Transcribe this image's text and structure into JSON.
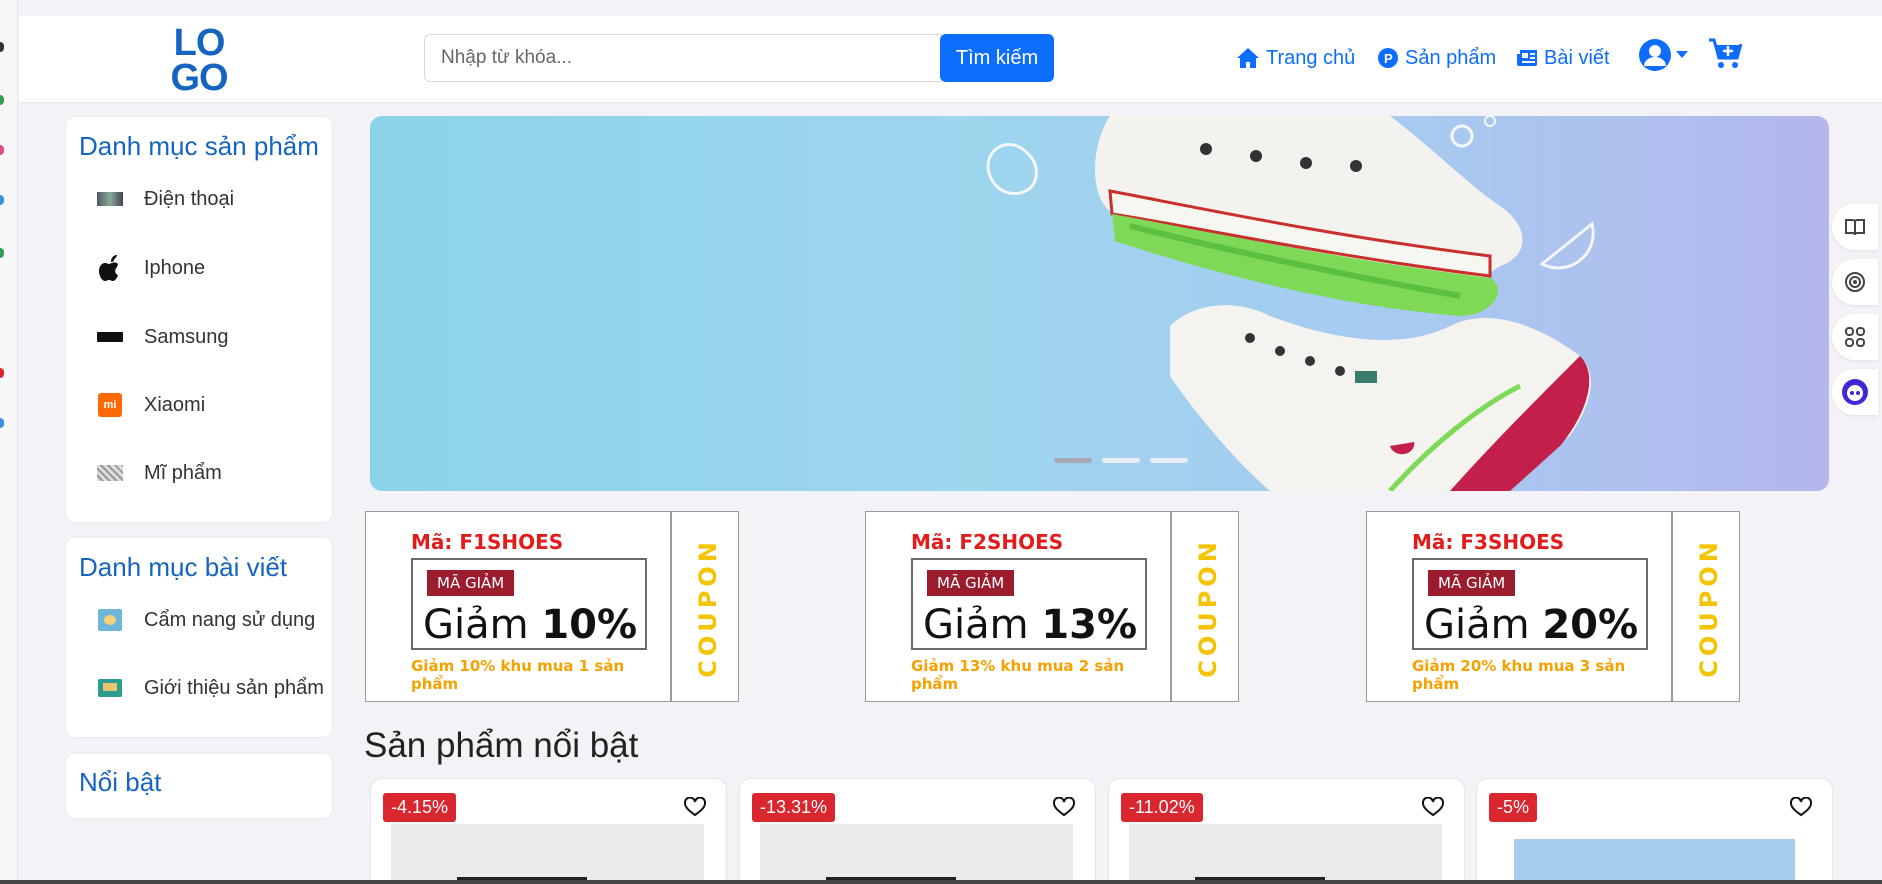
{
  "header": {
    "logo_top": "LO",
    "logo_bottom": "GO",
    "search_placeholder": "Nhập từ khóa...",
    "search_button": "Tìm kiếm",
    "nav": [
      {
        "label": "Trang chủ",
        "icon": "home-icon"
      },
      {
        "label": "Sản phẩm",
        "icon": "product-icon"
      },
      {
        "label": "Bài viết",
        "icon": "newspaper-icon"
      }
    ]
  },
  "sidebar": {
    "product_categories_title": "Danh mục sản phẩm",
    "product_categories": [
      {
        "label": "Điện thoại",
        "icon": "phone-thumbnail-icon"
      },
      {
        "label": "Iphone",
        "icon": "apple-icon"
      },
      {
        "label": "Samsung",
        "icon": "samsung-icon"
      },
      {
        "label": "Xiaomi",
        "icon": "xiaomi-icon"
      },
      {
        "label": "Mĩ phẩm",
        "icon": "cosmetics-thumbnail-icon"
      }
    ],
    "post_categories_title": "Danh mục bài viết",
    "post_categories": [
      {
        "label": "Cẩm nang sử dụng",
        "icon": "guide-thumbnail-icon"
      },
      {
        "label": "Giới thiệu sản phẩm",
        "icon": "intro-thumbnail-icon"
      }
    ],
    "featured_title": "Nổi bật"
  },
  "banner": {
    "slides": 3,
    "active_slide": 1
  },
  "coupons": [
    {
      "code": "Mã: F1SHOES",
      "tag": "MÃ GIẢM",
      "word": "Giảm",
      "percent": "10%",
      "desc": "Giảm 10% khu mua 1 sản phẩm",
      "stub": "COUPON"
    },
    {
      "code": "Mã: F2SHOES",
      "tag": "MÃ GIẢM",
      "word": "Giảm",
      "percent": "13%",
      "desc": "Giảm 13% khu mua 2 sản phẩm",
      "stub": "COUPON"
    },
    {
      "code": "Mã: F3SHOES",
      "tag": "MÃ GIẢM",
      "word": "Giảm",
      "percent": "20%",
      "desc": "Giảm 20% khu mua 3 sản phẩm",
      "stub": "COUPON"
    }
  ],
  "featured": {
    "title": "Sản phẩm nổi bật",
    "products": [
      {
        "discount": "-4.15%"
      },
      {
        "discount": "-13.31%"
      },
      {
        "discount": "-11.02%"
      },
      {
        "discount": "-5%"
      }
    ]
  },
  "colors": {
    "primary": "#0d6efd",
    "heading_blue": "#1565c0",
    "badge_red": "#d9262f",
    "coupon_code_red": "#e21b1b",
    "coupon_yellow": "#f5c300"
  }
}
